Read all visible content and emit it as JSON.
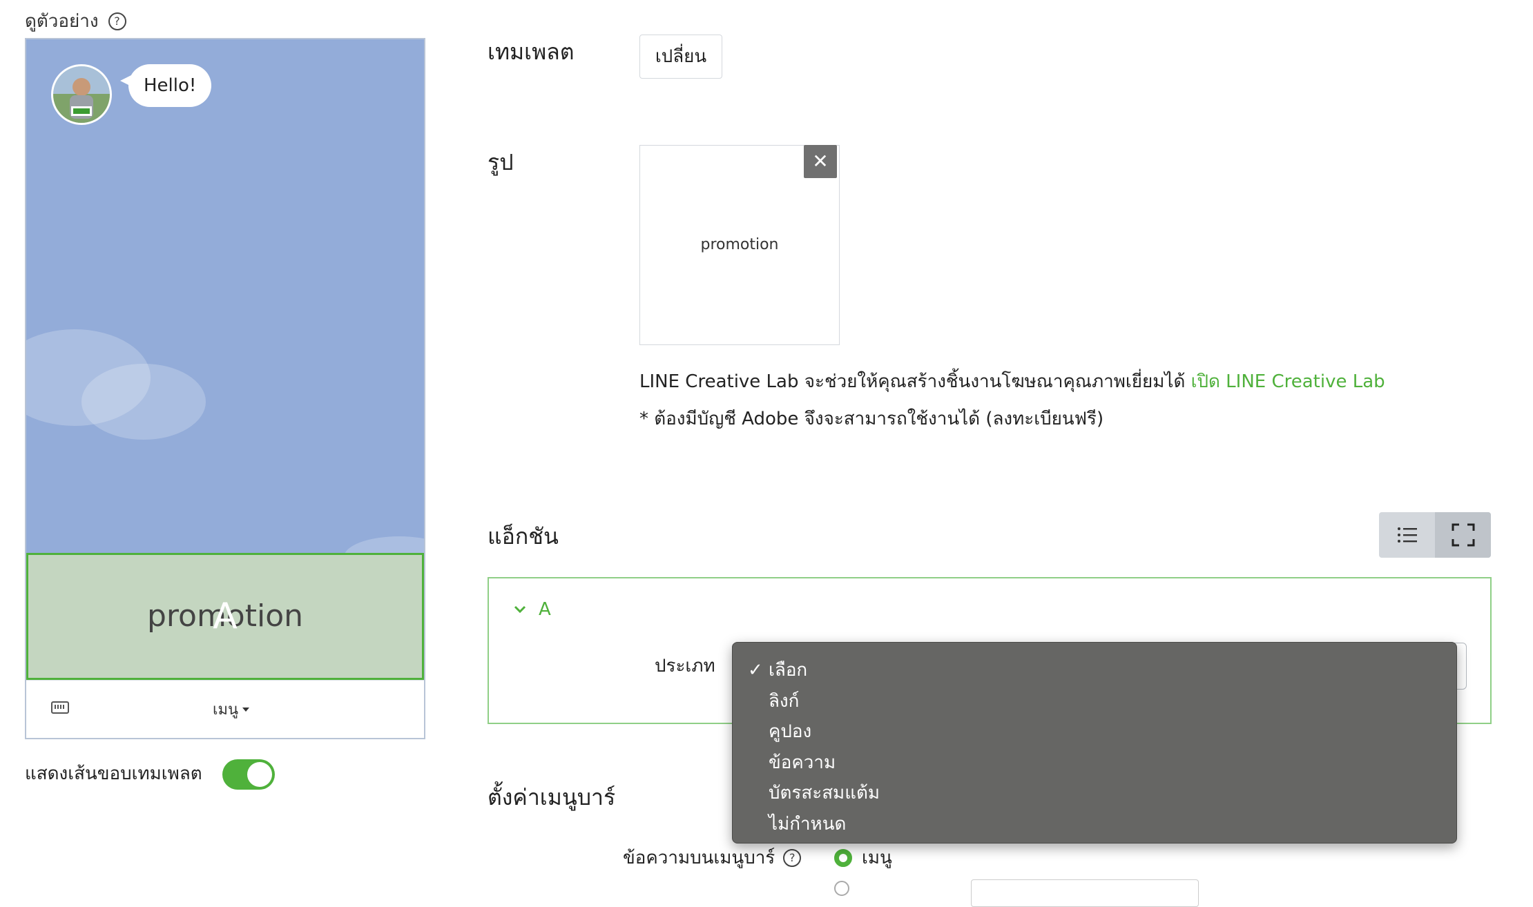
{
  "preview": {
    "label": "ดูตัวอย่าง",
    "help_icon": "question-circle-icon",
    "chat_bubble": "Hello!",
    "rich_menu_image_text": "promotion",
    "area_letter": "A",
    "menu_toggle_label": "เมนู",
    "keyboard_icon": "keyboard-icon",
    "show_border_label": "แสดงเส้นขอบเทมเพลต",
    "show_border_on": true
  },
  "colors": {
    "accent": "#4fb13b",
    "chat_background": "#93acd9",
    "dropdown_background": "#666664"
  },
  "template": {
    "label": "เทมเพลต",
    "change_button": "เปลี่ยน"
  },
  "image": {
    "label": "รูป",
    "card_text": "promotion",
    "remove_icon": "close-icon",
    "creative_lab_text": "LINE Creative Lab จะช่วยให้คุณสร้างชิ้นงานโฆษณาคุณภาพเยี่ยมได้ ",
    "creative_lab_link": "เปิด LINE Creative Lab",
    "adobe_note": "* ต้องมีบัญชี Adobe จึงจะสามารถใช้งานได้ (ลงทะเบียนฟรี)"
  },
  "action": {
    "label": "แอ็กชัน",
    "view_icons": [
      "list-icon",
      "fullscreen-icon"
    ],
    "area_name": "A",
    "type_label": "ประเภท",
    "dropdown_options": [
      "เลือก",
      "ลิงก์",
      "คูปอง",
      "ข้อความ",
      "บัตรสะสมแต้ม",
      "ไม่กำหนด"
    ],
    "selected_option": "เลือก"
  },
  "menubar": {
    "title": "ตั้งค่าเมนูบาร์",
    "text_label": "ข้อความบนเมนูบาร์",
    "option_menu": "เมนู"
  }
}
